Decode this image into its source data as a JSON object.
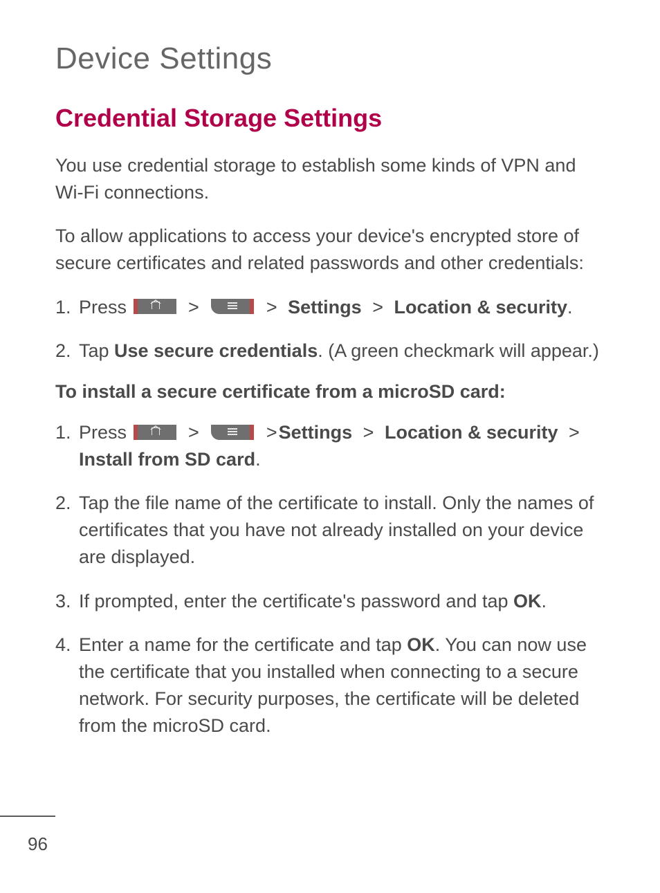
{
  "page_title": "Device Settings",
  "section_heading": "Credential Storage Settings",
  "intro_1": "You use credential storage to establish some kinds of VPN and Wi-Fi connections.",
  "intro_2": "To allow applications to access your device's encrypted store of secure certificates and related passwords and other credentials:",
  "stepsA": {
    "s1_num": "1.",
    "s1_a": "Press ",
    "s1_b": "Settings",
    "s1_c": "Location & security",
    "s1_d": ".",
    "s2_num": "2.",
    "s2_a": "Tap ",
    "s2_b": "Use secure credentials",
    "s2_c": ". (A green checkmark will appear.)"
  },
  "sub_heading": "To install a secure certificate from a microSD card:",
  "stepsB": {
    "s1_num": "1.",
    "s1_a": "Press ",
    "s1_b": "Settings",
    "s1_c": "Location & security",
    "s1_d": "Install from SD card",
    "s1_e": ".",
    "s2_num": "2.",
    "s2": "Tap the file name of the certificate to install. Only the names of certificates that you have not already installed on your device are displayed.",
    "s3_num": "3.",
    "s3_a": "If prompted, enter the certificate's password and tap ",
    "s3_b": "OK",
    "s3_c": ".",
    "s4_num": "4.",
    "s4_a": "Enter a name for the certificate and tap ",
    "s4_b": "OK",
    "s4_c": ". You can now use the certificate that you installed when connecting to a secure network. For security purposes, the certificate will be deleted from the microSD card."
  },
  "gt": ">",
  "page_number": "96"
}
